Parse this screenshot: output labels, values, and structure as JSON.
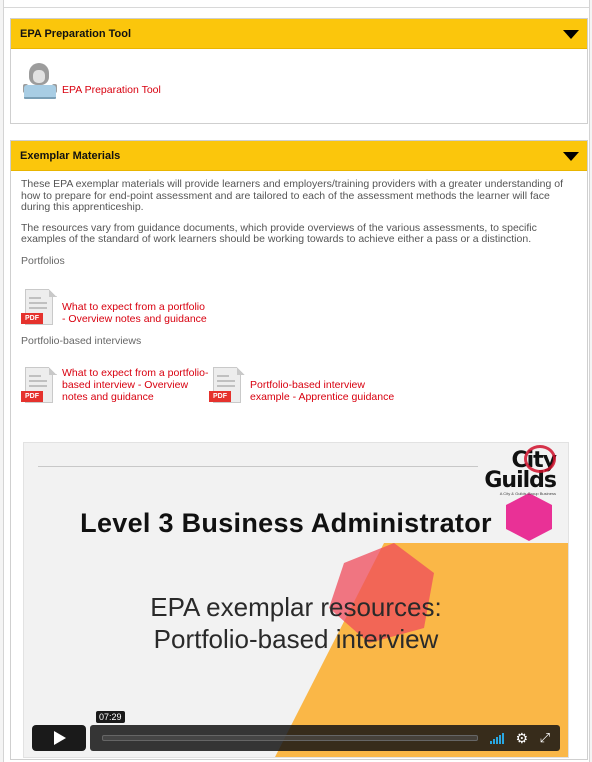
{
  "tool_section": {
    "header": "EPA Preparation Tool",
    "link_label": "EPA Preparation Tool"
  },
  "materials_section": {
    "header": "Exemplar Materials",
    "paragraph_1": "These EPA exemplar materials will provide learners and employers/training providers with a greater understanding of how to prepare for end-point assessment and are tailored to each of the assessment methods the learner will face during this apprenticeship.",
    "paragraph_2": "The resources vary from guidance documents, which provide overviews of the various assessments, to specific examples of the standard of work learners should be working towards to achieve either a pass or a distinction.",
    "portfolios_label": "Portfolios",
    "portfolio_docs": [
      {
        "label_line1": "What to expect from a portfolio",
        "label_line2": "- Overview notes and guidance",
        "icon_tag": "PDF"
      }
    ],
    "interviews_label": "Portfolio-based interviews",
    "interview_docs": [
      {
        "label_line1": "What to expect from a portfolio-",
        "label_line2": "based interview - Overview",
        "label_line3": "notes and guidance",
        "icon_tag": "PDF"
      },
      {
        "label_line1": "Portfolio-based interview",
        "label_line2": "example - Apprentice guidance",
        "icon_tag": "PDF"
      }
    ]
  },
  "video": {
    "logo_line1": "City",
    "logo_line2": "Guilds",
    "logo_tagline": "A City & Guilds Group Business",
    "title": "Level 3 Business Administrator",
    "subtitle_line1": "EPA exemplar resources:",
    "subtitle_line2": "Portfolio-based interview",
    "duration": "07:29",
    "colors": {
      "accent_orange": "#fbb034",
      "accent_red": "#ef4b5b",
      "accent_pink": "#e6007e",
      "volume": "#2aa7e0"
    }
  },
  "colors": {
    "header_yellow": "#fbc60c",
    "link_red": "#d8000f"
  }
}
